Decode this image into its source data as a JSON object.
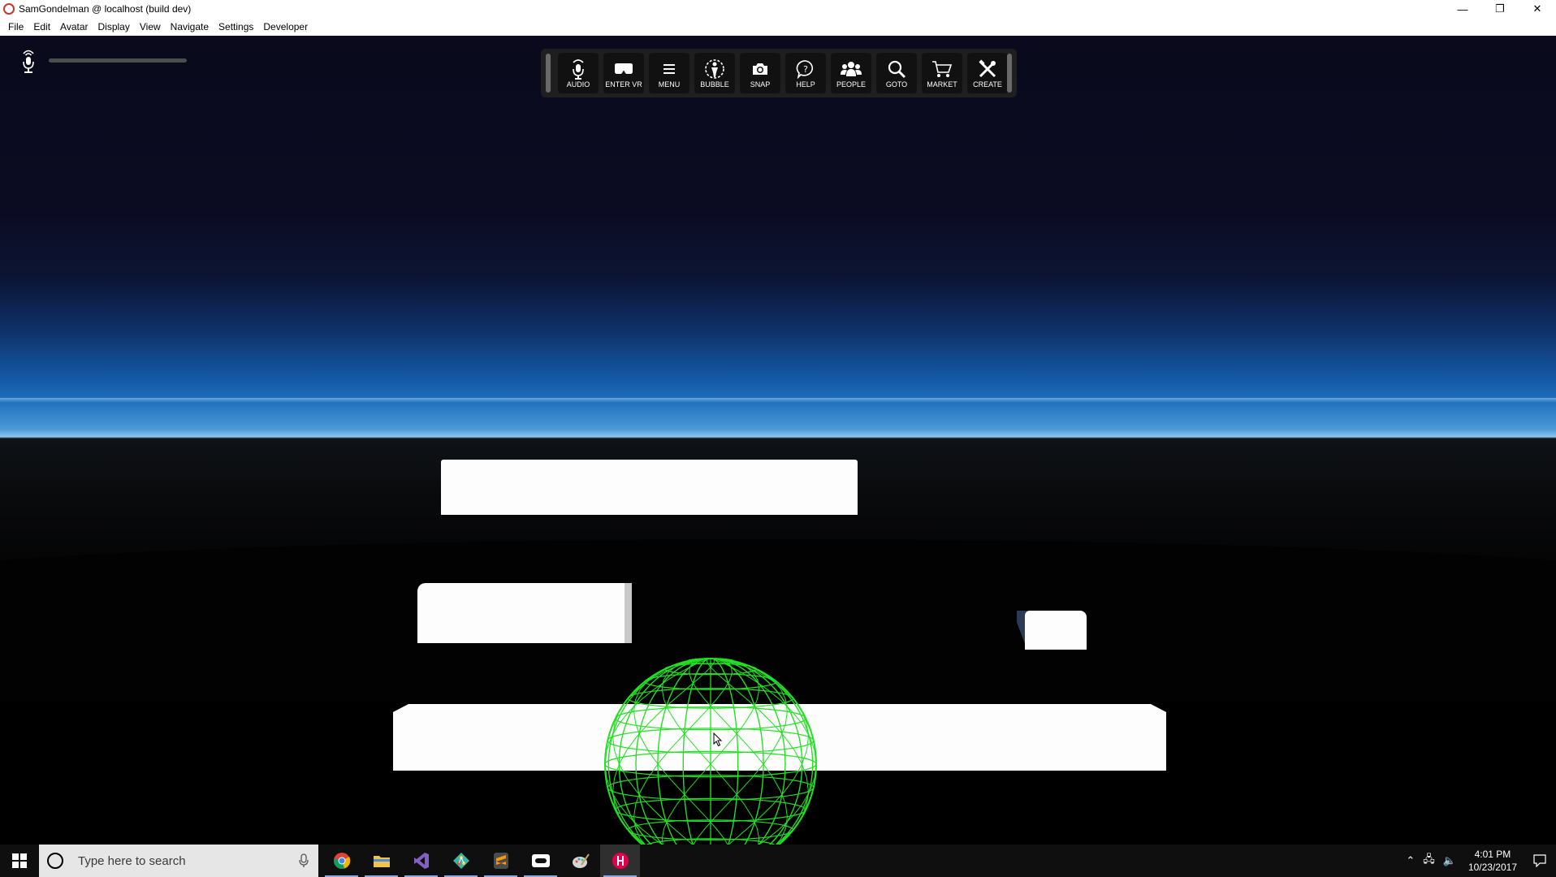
{
  "window": {
    "title": "SamGondelman @ localhost (build dev)",
    "controls": {
      "minimize": "—",
      "restore": "❐",
      "close": "✕"
    }
  },
  "menu": [
    "File",
    "Edit",
    "Avatar",
    "Display",
    "View",
    "Navigate",
    "Settings",
    "Developer"
  ],
  "toolbar": {
    "buttons": [
      {
        "label": "AUDIO",
        "icon": "mic-icon"
      },
      {
        "label": "ENTER VR",
        "icon": "vr-headset-icon"
      },
      {
        "label": "MENU",
        "icon": "hamburger-icon"
      },
      {
        "label": "BUBBLE",
        "icon": "bubble-icon"
      },
      {
        "label": "SNAP",
        "icon": "camera-icon"
      },
      {
        "label": "HELP",
        "icon": "help-icon"
      },
      {
        "label": "PEOPLE",
        "icon": "people-icon"
      },
      {
        "label": "GOTO",
        "icon": "magnifier-icon"
      },
      {
        "label": "MARKET",
        "icon": "cart-icon"
      },
      {
        "label": "CREATE",
        "icon": "tools-icon"
      }
    ]
  },
  "taskbar": {
    "search_placeholder": "Type here to search",
    "apps": [
      "chrome",
      "file-explorer",
      "visual-studio",
      "git-client",
      "sublime-text",
      "oculus",
      "paint",
      "high-fidelity"
    ],
    "time": "4:01 PM",
    "date": "10/23/2017"
  },
  "colors": {
    "wireframe": "#22e022",
    "toolbar_bg": "#1f1f1f",
    "sky_horizon": "#1e6fbd"
  }
}
